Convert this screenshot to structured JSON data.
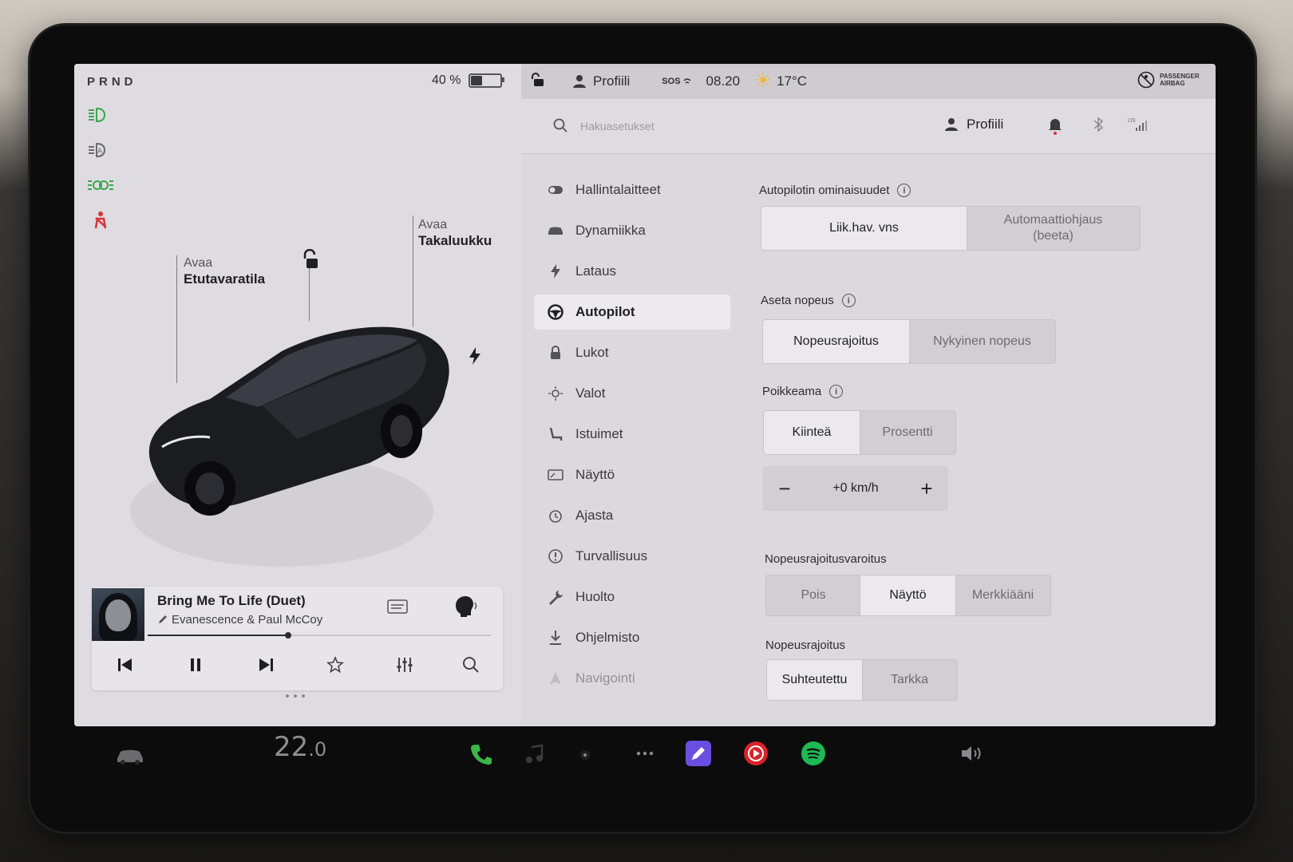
{
  "status": {
    "gear": "PRND",
    "battery_percent": "40 %",
    "battery_level": 0.4,
    "profile": "Profiili",
    "sos": "SOS",
    "time": "08.20",
    "outside_temp": "17°C",
    "airbag": "PASSENGER AIRBAG"
  },
  "car": {
    "frunk_action": "Avaa",
    "frunk_label": "Etutavaratila",
    "trunk_action": "Avaa",
    "trunk_label": "Takaluukku"
  },
  "media": {
    "title": "Bring Me To Life (Duet)",
    "artist": "Evanescence & Paul McCoy",
    "progress": 0.41
  },
  "search": {
    "placeholder": "Hakuasetukset",
    "profile": "Profiili"
  },
  "menu": {
    "items": [
      {
        "label": "Hallintalaitteet",
        "icon": "toggle-icon"
      },
      {
        "label": "Dynamiikka",
        "icon": "car-icon"
      },
      {
        "label": "Lataus",
        "icon": "bolt-icon"
      },
      {
        "label": "Autopilot",
        "icon": "steering-wheel-icon"
      },
      {
        "label": "Lukot",
        "icon": "lock-icon"
      },
      {
        "label": "Valot",
        "icon": "sun-icon"
      },
      {
        "label": "Istuimet",
        "icon": "seat-icon"
      },
      {
        "label": "Näyttö",
        "icon": "display-icon"
      },
      {
        "label": "Ajasta",
        "icon": "alarm-icon"
      },
      {
        "label": "Turvallisuus",
        "icon": "alert-icon"
      },
      {
        "label": "Huolto",
        "icon": "wrench-icon"
      },
      {
        "label": "Ohjelmisto",
        "icon": "download-icon"
      },
      {
        "label": "Navigointi",
        "icon": "navigation-icon"
      }
    ],
    "active_index": 3
  },
  "autopilot": {
    "features_title": "Autopilotin ominaisuudet",
    "features_opt1": "Liik.hav. vns",
    "features_opt2": "Automaattiohjaus (beeta)",
    "speed_title": "Aseta nopeus",
    "speed_opt1": "Nopeusrajoitus",
    "speed_opt2": "Nykyinen nopeus",
    "offset_title": "Poikkeama",
    "offset_opt1": "Kiinteä",
    "offset_opt2": "Prosentti",
    "offset_minus": "−",
    "offset_value": "+0 km/h",
    "offset_plus": "+",
    "warning_title": "Nopeusrajoitusvaroitus",
    "warning_opt1": "Pois",
    "warning_opt2": "Näyttö",
    "warning_opt3": "Merkkiääni",
    "limit_title": "Nopeusrajoitus",
    "limit_opt1": "Suhteutettu",
    "limit_opt2": "Tarkka"
  },
  "dock": {
    "temperature": "22.0",
    "temperature_int": "22",
    "temperature_dec": ".0"
  }
}
